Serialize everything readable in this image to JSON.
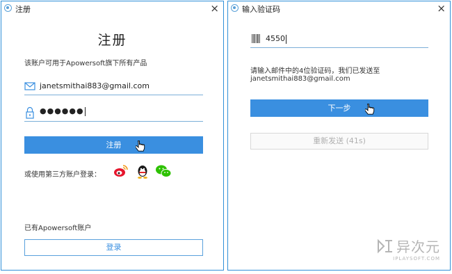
{
  "register_window": {
    "title": "注册",
    "close_glyph": "×",
    "heading": "注册",
    "subtext": "该账户可用于Apowersoft旗下所有产品",
    "email_value": "janetsmithai883@gmail.com",
    "password_mask": "●●●●●●",
    "register_button": "注册",
    "social_prompt": "或使用第三方账户登录：",
    "social_icons": [
      "weibo-icon",
      "qq-icon",
      "wechat-icon"
    ],
    "have_account_text": "已有Apowersoft账户",
    "login_button": "登录"
  },
  "verify_window": {
    "title": "输入验证码",
    "close_glyph": "×",
    "code_value": "4550",
    "info_line1": "请输入邮件中的4位验证码，我们已发送至",
    "info_line2": "janetsmithai883@gmail.com",
    "next_button": "下一步",
    "resend_button": "重新发送 (41s)"
  },
  "watermark": {
    "main": "异次元",
    "sub": "IPLAYSOFT.COM"
  },
  "colors": {
    "accent": "#3a8fe0",
    "border": "#2f8fd8",
    "watermark": "#b5b5b5"
  }
}
